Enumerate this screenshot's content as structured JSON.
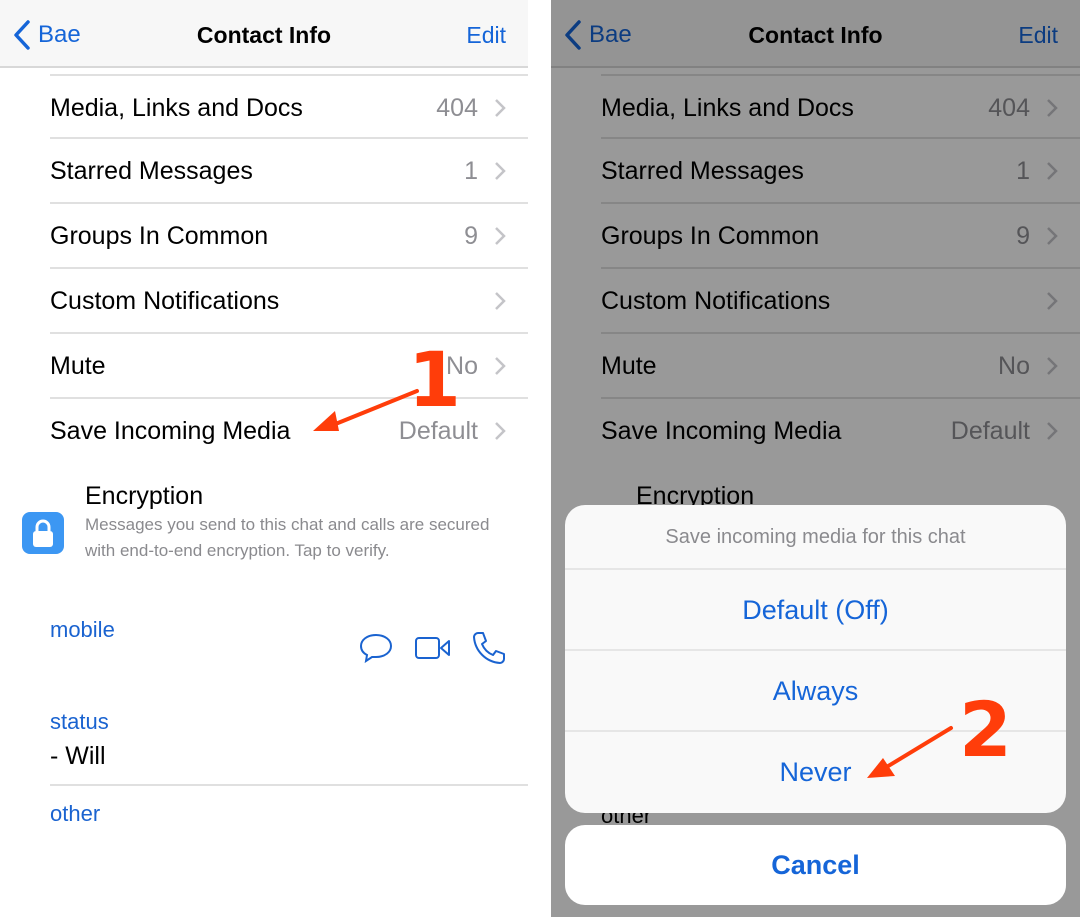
{
  "colors": {
    "accent": "#1565d8",
    "annotation": "#ff3d0a",
    "lock_bg": "#3c97f3",
    "secondary_text": "#8e8e93"
  },
  "navbar": {
    "back_label": "Bae",
    "title": "Contact Info",
    "edit_label": "Edit"
  },
  "rows": [
    {
      "label": "Media, Links and Docs",
      "value": "404"
    },
    {
      "label": "Starred Messages",
      "value": "1"
    },
    {
      "label": "Groups In Common",
      "value": "9"
    },
    {
      "label": "Custom Notifications",
      "value": ""
    },
    {
      "label": "Mute",
      "value": "No"
    },
    {
      "label": "Save Incoming Media",
      "value": "Default"
    }
  ],
  "encryption": {
    "title": "Encryption",
    "description": "Messages you send to this chat and calls are secured with end-to-end encryption. Tap to verify."
  },
  "phone": {
    "label": "mobile",
    "actions": [
      "message-icon",
      "video-call-icon",
      "voice-call-icon"
    ]
  },
  "status": {
    "label": "status",
    "value": "- Will"
  },
  "other": {
    "label": "other"
  },
  "action_sheet": {
    "title": "Save incoming media for this chat",
    "options": [
      "Default (Off)",
      "Always",
      "Never"
    ],
    "cancel_label": "Cancel"
  },
  "annotations": {
    "step1": "1",
    "step2": "2"
  }
}
